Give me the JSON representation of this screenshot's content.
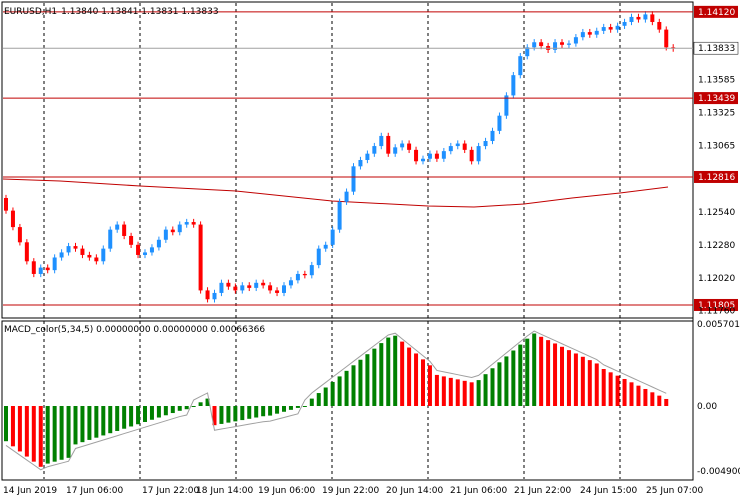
{
  "header": {
    "symbol": "EURUSD,H1",
    "ohlc": "1.13840 1.13841 1.13831 1.13833"
  },
  "indicator": {
    "label": "MACD_color(5,34,5) 0.00000000 0.00000000 0.00066366",
    "scale_labels": [
      "0.0057012",
      "0.00",
      "-0.0049000"
    ]
  },
  "colors": {
    "bull": "#1e90ff",
    "bear": "#ff0000",
    "hline": "#c00000",
    "current": "#a0a0a0",
    "ma": "#c00000",
    "hist_up": "#008000",
    "hist_down": "#ff0000",
    "macd_line": "#a0a0a0",
    "grid": "#000000"
  },
  "horizontal_levels": [
    {
      "price": "1.14120",
      "value": 1.1412
    },
    {
      "price": "1.13439",
      "value": 1.13439
    },
    {
      "price": "1.12816",
      "value": 1.12816
    },
    {
      "price": "1.11805",
      "value": 1.11805
    }
  ],
  "current_price": {
    "label": "1.13833",
    "value": 1.13833
  },
  "price_axis_labels": [
    "1.13585",
    "1.13325",
    "1.13065",
    "1.12540",
    "1.12280",
    "1.12020",
    "1.11760"
  ],
  "time_axis_labels": [
    "14 Jun 2019",
    "17 Jun 06:00",
    "17 Jun 22:00",
    "18 Jun 14:00",
    "19 Jun 06:00",
    "19 Jun 22:00",
    "20 Jun 14:00",
    "21 Jun 06:00",
    "21 Jun 22:00",
    "24 Jun 15:00",
    "25 Jun 07:00"
  ],
  "chart_data": {
    "type": "candlestick",
    "y_range": [
      1.1171,
      1.1419
    ],
    "closes": [
      1.1255,
      1.1242,
      1.123,
      1.1215,
      1.1205,
      1.121,
      1.1208,
      1.1218,
      1.1222,
      1.1227,
      1.1225,
      1.122,
      1.1218,
      1.1215,
      1.1225,
      1.124,
      1.1244,
      1.1235,
      1.1228,
      1.122,
      1.1222,
      1.1226,
      1.1232,
      1.124,
      1.1238,
      1.1244,
      1.1246,
      1.1244,
      1.1192,
      1.1185,
      1.119,
      1.1198,
      1.1195,
      1.1192,
      1.1196,
      1.1194,
      1.1198,
      1.1196,
      1.1192,
      1.119,
      1.1196,
      1.12,
      1.1205,
      1.1204,
      1.1212,
      1.1225,
      1.1228,
      1.124,
      1.1262,
      1.127,
      1.129,
      1.1295,
      1.13,
      1.1306,
      1.1314,
      1.13,
      1.1305,
      1.1308,
      1.1303,
      1.1294,
      1.1296,
      1.13,
      1.1296,
      1.1302,
      1.1306,
      1.1308,
      1.1303,
      1.1294,
      1.1306,
      1.131,
      1.1318,
      1.133,
      1.1346,
      1.1362,
      1.1377,
      1.1384,
      1.1388,
      1.1385,
      1.1382,
      1.1388,
      1.1386,
      1.1387,
      1.1392,
      1.1396,
      1.1394,
      1.1397,
      1.14,
      1.1398,
      1.1401,
      1.1404,
      1.1408,
      1.1406,
      1.141,
      1.1404,
      1.1398,
      1.1384,
      1.1383
    ]
  }
}
